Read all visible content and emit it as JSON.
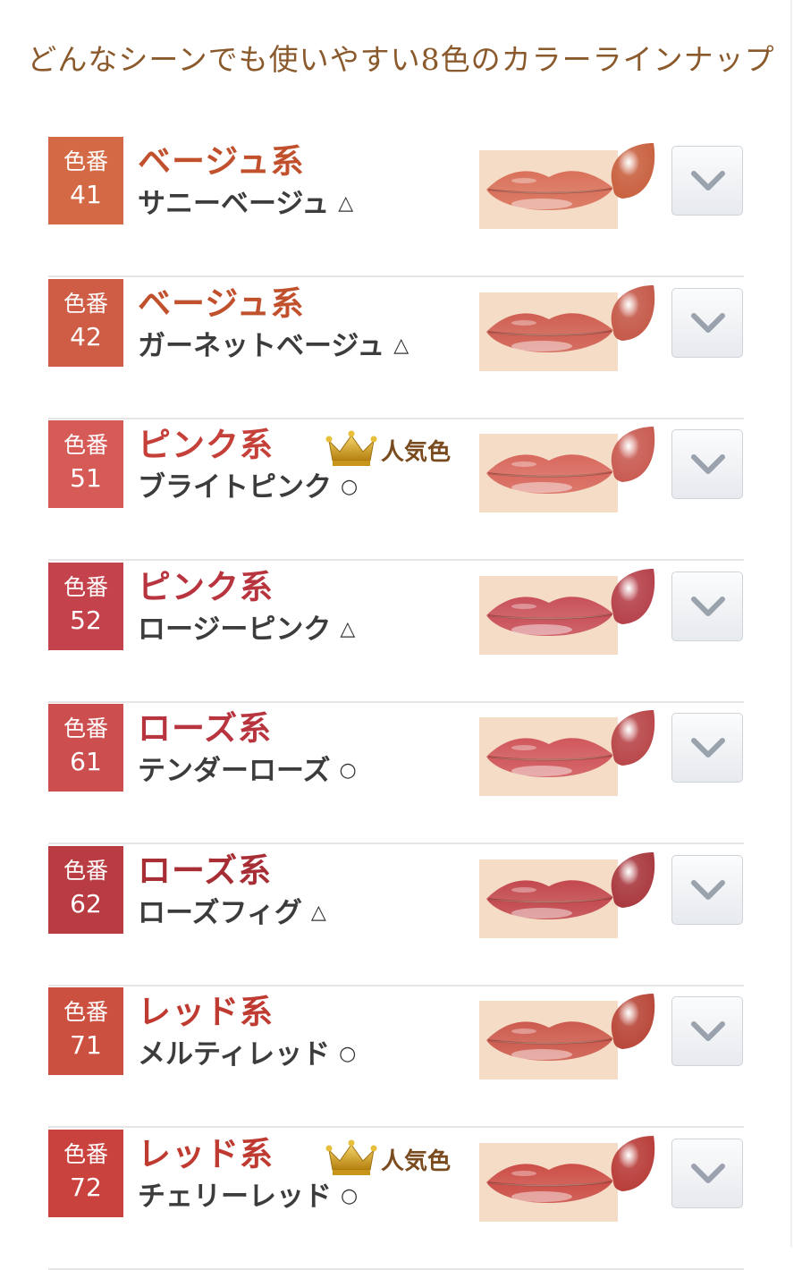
{
  "header": {
    "title": "どんなシーンでも使いやすい8色のカラーラインナップ"
  },
  "badge_label": "色番",
  "popular_label": "人気色",
  "items": [
    {
      "number": "41",
      "family": "ベージュ系",
      "shade": "サニーベージュ",
      "mark": "△",
      "popular": false,
      "badge_color": "#d46a45",
      "family_color": "#c1502c",
      "lip_color": "#d9705a",
      "bullet_color": "#c8603f"
    },
    {
      "number": "42",
      "family": "ベージュ系",
      "shade": "ガーネットベージュ",
      "mark": "△",
      "popular": false,
      "badge_color": "#cf5c45",
      "family_color": "#c1502c",
      "lip_color": "#cf5e52",
      "bullet_color": "#c45848"
    },
    {
      "number": "51",
      "family": "ピンク系",
      "shade": "ブライトピンク",
      "mark": "○",
      "popular": true,
      "badge_color": "#d65a55",
      "family_color": "#c6403a",
      "lip_color": "#d8685e",
      "bullet_color": "#c85a50"
    },
    {
      "number": "52",
      "family": "ピンク系",
      "shade": "ロージーピンク",
      "mark": "△",
      "popular": false,
      "badge_color": "#c4424b",
      "family_color": "#b8353f",
      "lip_color": "#c8505a",
      "bullet_color": "#b5404a"
    },
    {
      "number": "61",
      "family": "ローズ系",
      "shade": "テンダーローズ",
      "mark": "○",
      "popular": false,
      "badge_color": "#cc4e4f",
      "family_color": "#b8353f",
      "lip_color": "#d0575b",
      "bullet_color": "#b84548"
    },
    {
      "number": "62",
      "family": "ローズ系",
      "shade": "ローズフィグ",
      "mark": "△",
      "popular": false,
      "badge_color": "#b83c41",
      "family_color": "#a82e36",
      "lip_color": "#c2484e",
      "bullet_color": "#a8383e"
    },
    {
      "number": "71",
      "family": "レッド系",
      "shade": "メルティレッド",
      "mark": "○",
      "popular": false,
      "badge_color": "#cc5040",
      "family_color": "#bf3a30",
      "lip_color": "#cc5a4e",
      "bullet_color": "#b84638"
    },
    {
      "number": "72",
      "family": "レッド系",
      "shade": "チェリーレッド",
      "mark": "○",
      "popular": true,
      "badge_color": "#c9423d",
      "family_color": "#bf3a30",
      "lip_color": "#cc4e48",
      "bullet_color": "#b83c38"
    }
  ],
  "colors": {
    "title": "#8a5a2c",
    "skin": "#f5dcc6",
    "chevron": "#9aa3ad",
    "crown": "#d4a21c"
  }
}
